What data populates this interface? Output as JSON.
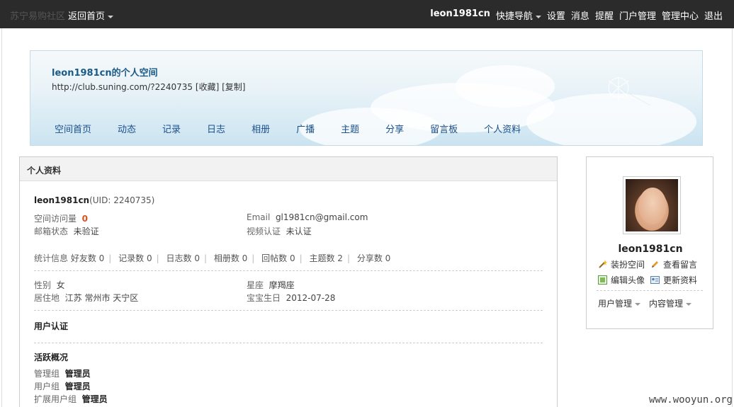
{
  "topbar": {
    "site": "苏宁易购社区",
    "back": "返回首页",
    "user": "leon1981cn",
    "items": [
      "快捷导航",
      "设置",
      "消息",
      "提醒",
      "门户管理",
      "管理中心",
      "退出"
    ]
  },
  "banner": {
    "title": "leon1981cn的个人空间",
    "url": "http://club.suning.com/?2240735",
    "fav": "[收藏]",
    "copy": "[复制]",
    "nav": [
      "空间首页",
      "动态",
      "记录",
      "日志",
      "相册",
      "广播",
      "主题",
      "分享",
      "留言板",
      "个人资料"
    ]
  },
  "panel": {
    "title": "个人资料",
    "username": "leon1981cn",
    "uid": "(UID: 2240735)",
    "visits_label": "空间访问量",
    "visits": "0",
    "email_label": "Email",
    "email": "gl1981cn@gmail.com",
    "mail_status_label": "邮箱状态",
    "mail_status": "未验证",
    "video_label": "视频认证",
    "video": "未认证",
    "stats_label": "统计信息",
    "stats": [
      "好友数 0",
      "记录数 0",
      "日志数 0",
      "相册数 0",
      "回帖数 0",
      "主题数 2",
      "分享数 0"
    ],
    "gender_label": "性别",
    "gender": "女",
    "zodiac_label": "星座",
    "zodiac": "摩羯座",
    "residence_label": "居住地",
    "residence": "江苏 常州市 天宁区",
    "baby_label": "宝宝生日",
    "baby": "2012-07-28",
    "auth_title": "用户认证",
    "activity_title": "活跃概况",
    "mgmt_label": "管理组",
    "mgmt": "管理员",
    "group_label": "用户组",
    "group": "管理员",
    "ext_label": "扩展用户组",
    "ext": "管理员"
  },
  "side": {
    "name": "leon1981cn",
    "decorate": "装扮空间",
    "messages": "查看留言",
    "edit_avatar": "编辑头像",
    "update_profile": "更新资料",
    "user_mgmt": "用户管理",
    "content_mgmt": "内容管理"
  },
  "watermark": "www.wooyun.org"
}
